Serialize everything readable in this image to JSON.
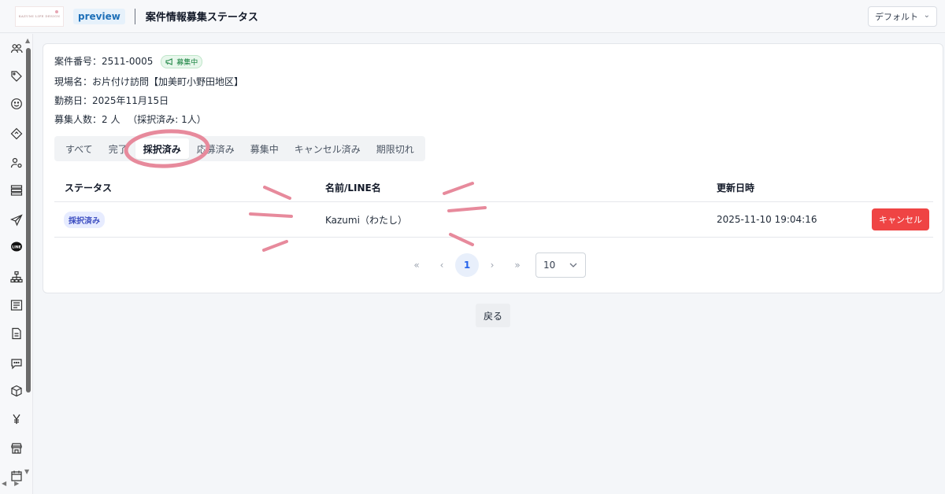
{
  "header": {
    "logo_text": "KAZUMI LIFE DESIGN",
    "preview_label": "preview",
    "title": "案件情報募集ステータス",
    "view_select": "デフォルト"
  },
  "case": {
    "number_label": "案件番号：",
    "number": "2511-0005",
    "status": "募集中",
    "site_label": "現場名：",
    "site": "お片付け訪問【加美町小野田地区】",
    "date_label": "勤務日：",
    "date": "2025年11月15日",
    "count_label": "募集人数：",
    "count": "2 人",
    "adopted_note": "（採択済み: 1人）"
  },
  "tabs": [
    {
      "label": "すべて",
      "active": false
    },
    {
      "label": "完了",
      "active": false
    },
    {
      "label": "採択済み",
      "active": true
    },
    {
      "label": "応募済み",
      "active": false
    },
    {
      "label": "募集中",
      "active": false
    },
    {
      "label": "キャンセル済み",
      "active": false
    },
    {
      "label": "期限切れ",
      "active": false
    }
  ],
  "table": {
    "headers": [
      "ステータス",
      "名前/LINE名",
      "更新日時"
    ],
    "rows": [
      {
        "status": "採択済み",
        "name": "Kazumi（わたし）",
        "updated": "2025-11-10 19:04:16",
        "action": "キャンセル"
      }
    ]
  },
  "pagination": {
    "first": "«",
    "prev": "‹",
    "current": "1",
    "next": "›",
    "last": "»",
    "page_size": "10"
  },
  "back_label": "戻る",
  "sidebar_icons": [
    "users-icon",
    "tag-icon",
    "smile-icon",
    "ticket-icon",
    "user-settings-icon",
    "list-icon",
    "send-icon",
    "line-icon",
    "hierarchy-icon",
    "article-icon",
    "document-icon",
    "chat-icon",
    "box-icon",
    "yen-icon",
    "store-icon",
    "calendar-icon"
  ],
  "colors": {
    "accent": "#2563eb",
    "danger": "#ef4444",
    "annotation": "#e78a9c",
    "success": "#15803d"
  }
}
